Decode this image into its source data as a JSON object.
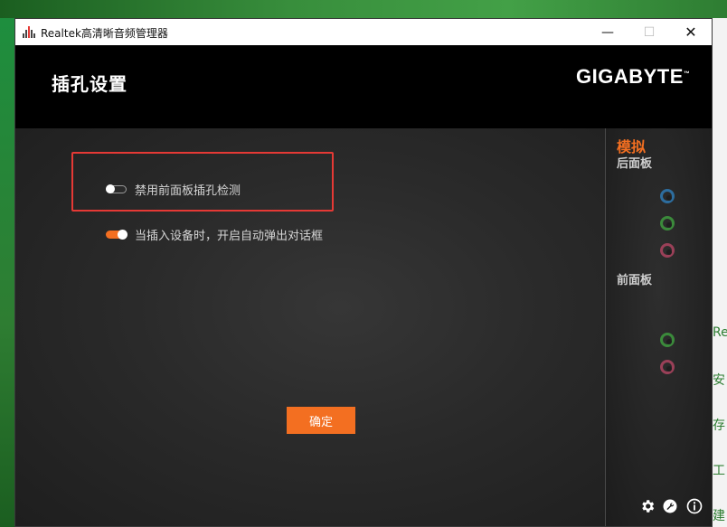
{
  "window": {
    "title": "Realtek高清晰音频管理器",
    "minimize_glyph": "—",
    "maximize_glyph": "☐",
    "close_glyph": "✕"
  },
  "header": {
    "page_title": "插孔设置",
    "brand": "GIGABYTE",
    "brand_mark": "™"
  },
  "settings": {
    "disable_front_panel_detection": {
      "label": "禁用前面板插孔检测",
      "enabled": false
    },
    "auto_popup_dialog": {
      "label": "当插入设备时，开启自动弹出对话框",
      "enabled": true
    }
  },
  "ok_button_label": "确定",
  "side_panel": {
    "tab_label": "模拟",
    "rear_panel_label": "后面板",
    "front_panel_label": "前面板",
    "rear_jacks": [
      {
        "name": "line-in-blue",
        "color": "#2d6d9e"
      },
      {
        "name": "line-out-green",
        "color": "#3b8a3b"
      },
      {
        "name": "mic-pink",
        "color": "#9a4058"
      }
    ],
    "front_jacks": [
      {
        "name": "headphone-green",
        "color": "#3b8a3b"
      },
      {
        "name": "mic-pink",
        "color": "#9a4058"
      }
    ],
    "footer_icons": [
      "gear-icon",
      "wrench-icon",
      "info-icon"
    ]
  },
  "colors": {
    "accent": "#f36f21",
    "highlight_box": "#e53935"
  },
  "desktop_right_fragments": [
    "Re",
    "安",
    "存",
    "工",
    "建"
  ]
}
